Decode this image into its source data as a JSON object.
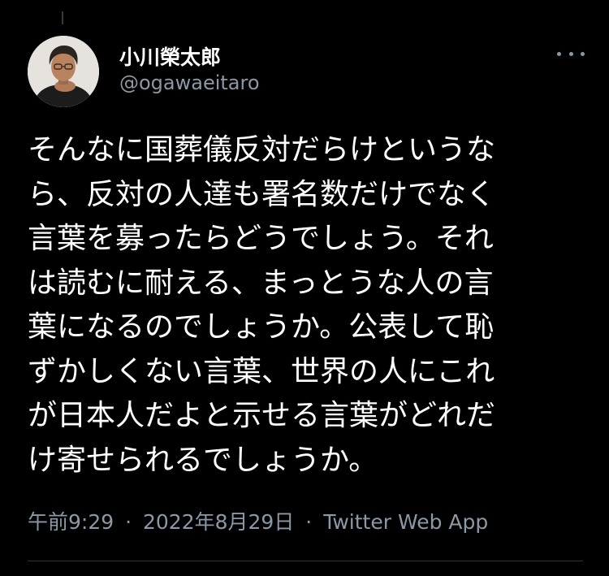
{
  "author": {
    "display_name": "小川榮太郎",
    "handle": "@ogawaeitaro",
    "avatar_icon": "profile-photo"
  },
  "more_icon": "more-horizontal-icon",
  "tweet": {
    "lines": [
      "そんなに国葬儀反対だらけというな",
      "ら、反対の人達も署名数だけでなく",
      "言葉を募ったらどうでしょう。それ",
      "は読むに耐える、まっとうな人の言",
      "葉になるのでしょうか。公表して恥",
      "ずかしくない言葉、世界の人にこれ",
      "が日本人だよと示せる言葉がどれだ",
      "け寄せられるでしょうか。"
    ]
  },
  "meta": {
    "time": "午前9:29",
    "separator": "·",
    "date": "2022年8月29日",
    "source": "Twitter Web App"
  },
  "colors": {
    "background": "#000000",
    "text_primary": "#ffffff",
    "text_secondary": "#8b98a5",
    "divider": "#2f3336"
  }
}
